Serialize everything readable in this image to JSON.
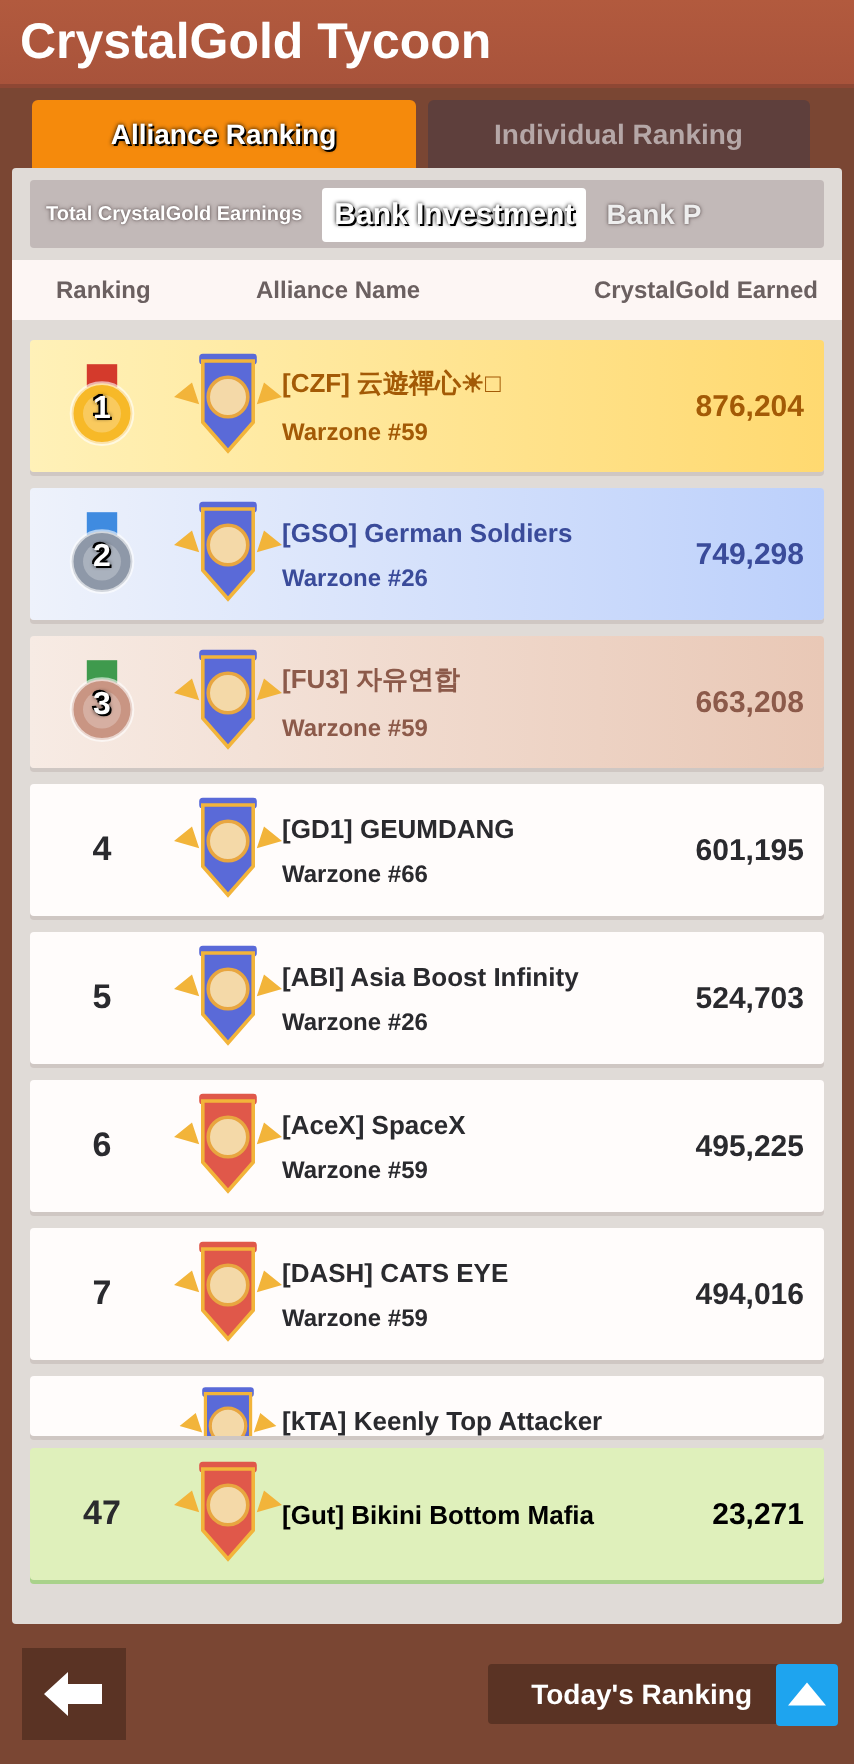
{
  "title": "CrystalGold Tycoon",
  "tabs": [
    {
      "label": "Alliance Ranking",
      "selected": true
    },
    {
      "label": "Individual Ranking",
      "selected": false
    }
  ],
  "subtabs": [
    {
      "label": "Total CrystalGold Earnings",
      "selected": false
    },
    {
      "label": "Bank Investment",
      "selected": true
    },
    {
      "label": "Bank P",
      "selected": false
    }
  ],
  "columns": [
    "Ranking",
    "Alliance Name",
    "CrystalGold Earned"
  ],
  "rows": [
    {
      "rank": "1",
      "kind": "gold",
      "color": "#5a6ad8",
      "name": "[CZF] 云遊禪心☀□",
      "warzone": "Warzone #59",
      "score": "876,204"
    },
    {
      "rank": "2",
      "kind": "silver",
      "color": "#5a6ad8",
      "name": "[GSO] German Soldiers",
      "warzone": "Warzone #26",
      "score": "749,298"
    },
    {
      "rank": "3",
      "kind": "bronze",
      "color": "#5a6ad8",
      "name": "[FU3] 자유연합",
      "warzone": "Warzone #59",
      "score": "663,208"
    },
    {
      "rank": "4",
      "kind": "plain",
      "color": "#5a6ad8",
      "name": "[GD1] GEUMDANG",
      "warzone": "Warzone #66",
      "score": "601,195"
    },
    {
      "rank": "5",
      "kind": "plain",
      "color": "#5a6ad8",
      "name": "[ABI] Asia Boost Infinity",
      "warzone": "Warzone #26",
      "score": "524,703"
    },
    {
      "rank": "6",
      "kind": "plain",
      "color": "#e0584a",
      "name": "[AceX] SpaceX",
      "warzone": "Warzone #59",
      "score": "495,225"
    },
    {
      "rank": "7",
      "kind": "plain",
      "color": "#e0584a",
      "name": "[DASH] CATS EYE",
      "warzone": "Warzone #59",
      "score": "494,016"
    },
    {
      "kind": "cut",
      "color": "#5a6ad8",
      "name": "[kTA] Keenly Top Attacker"
    }
  ],
  "own_row": {
    "rank": "47",
    "color": "#e0584a",
    "name": "[Gut] Bikini Bottom Mafia",
    "score": "23,271"
  },
  "todays_ranking": "Today's Ranking"
}
